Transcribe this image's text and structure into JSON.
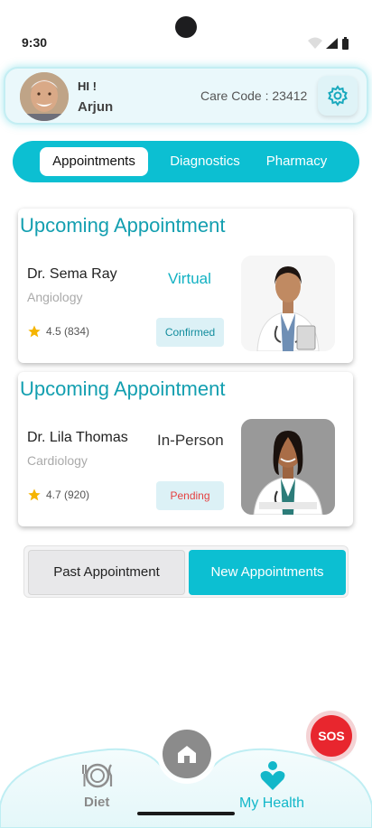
{
  "status_bar": {
    "time": "9:30"
  },
  "profile": {
    "greeting": "HI !",
    "name": "Arjun",
    "care_code": "Care Code : 23412"
  },
  "tabs": [
    {
      "label": "Appointments",
      "active": true
    },
    {
      "label": "Diagnostics",
      "active": false
    },
    {
      "label": "Pharmacy",
      "active": false
    }
  ],
  "appointments": [
    {
      "title": "Upcoming Appointment",
      "doctor": "Dr. Sema Ray",
      "specialty": "Angiology",
      "rating": "4.5 (834)",
      "visit_type": "Virtual",
      "status": "Confirmed",
      "visit_color": "#12b1c3",
      "status_color": "#138d9e"
    },
    {
      "title": "Upcoming Appointment",
      "doctor": "Dr. Lila Thomas",
      "specialty": "Cardiology",
      "rating": "4.7 (920)",
      "visit_type": "In-Person",
      "status": "Pending",
      "visit_color": "#333333",
      "status_color": "#e54040"
    }
  ],
  "appointment_switch": {
    "past_label": "Past Appointment",
    "new_label": "New Appointments"
  },
  "bottom_nav": {
    "diet_label": "Diet",
    "health_label": "My Health",
    "sos_label": "SOS"
  },
  "colors": {
    "accent": "#0cbfd2",
    "sos": "#e8262e",
    "title": "#139fb0"
  }
}
